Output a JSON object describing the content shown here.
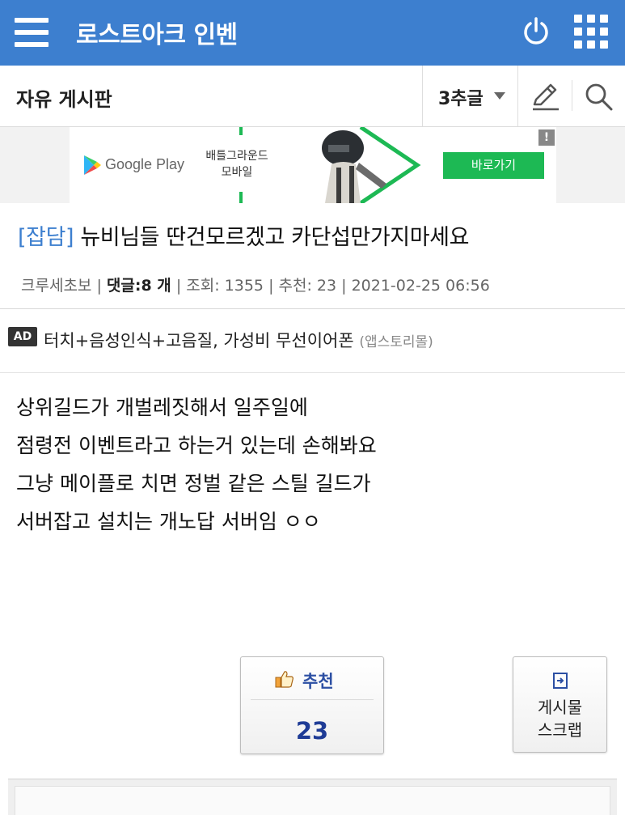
{
  "header": {
    "title": "로스트아크 인벤",
    "menu_icon": "hamburger-menu-icon",
    "power_icon": "power-icon",
    "apps_icon": "grid-apps-icon",
    "bg_color": "#3d7fcf"
  },
  "board": {
    "title": "자유 게시판",
    "sort_label": "3추글",
    "write_icon": "pencil-icon",
    "search_icon": "search-icon"
  },
  "banner_ad": {
    "store_text": "Google Play",
    "game_title_line1": "배틀그라운드",
    "game_title_line2": "모바일",
    "cta_label": "바로가기",
    "badge": "!",
    "accent_color": "#1db954"
  },
  "post": {
    "tag": "[잡담]",
    "title": " 뉴비님들 딴건모르겠고 카단섭만가지마세요",
    "author": "크루세초보",
    "comments_label": "댓글:",
    "comments_count": "8 개",
    "views": "조회: 1355",
    "recommends": "추천: 23",
    "datetime": "2021-02-25 06:56",
    "body_lines": [
      "상위길드가 개벌레짓해서 일주일에",
      "점령전 이벤트라고 하는거 있는데  손해봐요",
      "그냥 메이플로 치면 정벌 같은 스틸 길드가",
      "서버잡고 설치는 개노답 서버임 ㅇㅇ"
    ]
  },
  "text_ad": {
    "label": "AD",
    "text": "터치+음성인식+고음질, 가성비 무선이어폰",
    "source": "(앱스토리몰)"
  },
  "actions": {
    "recommend_label": "추천",
    "recommend_count": "23",
    "scrap_label_line1": "게시물",
    "scrap_label_line2": "스크랩"
  }
}
